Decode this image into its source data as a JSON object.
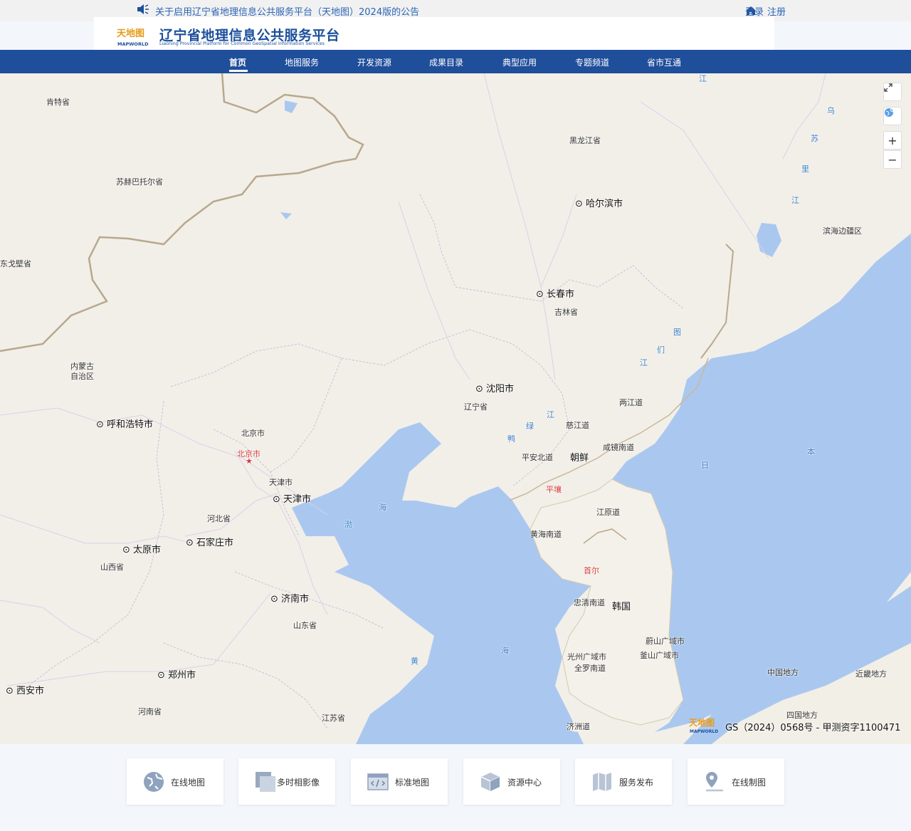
{
  "notice": {
    "text": "关于启用辽宁省地理信息公共服务平台（天地图）2024版的公告"
  },
  "header": {
    "login": "登录",
    "register": "注册"
  },
  "brand": {
    "title": "辽宁省地理信息公共服务平台",
    "subtitle": "Liaoning Provincial Platform for Common GeoSpatial Information Services",
    "logo_text": "MAPWORLD"
  },
  "nav": {
    "items": [
      "首页",
      "地图服务",
      "开发资源",
      "成果目录",
      "典型应用",
      "专题频道",
      "省市互通"
    ]
  },
  "map": {
    "tools": {
      "zoom_in": "+",
      "zoom_out": "−"
    },
    "labels": {
      "kenteaimag": "肯特省",
      "sukhbaatar": "苏赫巴托尔省",
      "dornogovi": "东戈壁省",
      "heilongjiang": "黑龙江省",
      "harbin": "哈尔滨市",
      "changchun": "长春市",
      "jilin": "吉林省",
      "neimenggu": "内蒙古\n自治区",
      "hohhot": "呼和浩特市",
      "shenyang": "沈阳市",
      "liaoning": "辽宁省",
      "beijing_prov": "北京市",
      "beijing": "北京市",
      "tianjin_prov": "天津市",
      "tianjin": "天津市",
      "hebei": "河北省",
      "shijiazhuang": "石家庄市",
      "taiyuan": "太原市",
      "shanxi": "山西省",
      "jinan": "济南市",
      "shandong": "山东省",
      "zhengzhou": "郑州市",
      "henan": "河南省",
      "xian": "西安市",
      "jiangsu": "江苏省",
      "binhai": "滨海边疆区",
      "lianggang": "两江道",
      "cijiang": "慈江道",
      "xianjingnan": "咸镜南道",
      "pinganbei": "平安北道",
      "chaoxian": "朝鲜",
      "pyongyang": "平壤",
      "jiangyuan": "江原道",
      "huanghainan": "黄海南道",
      "seoul": "首尔",
      "zhongqingnan": "忠清南道",
      "hanguo": "韩国",
      "ulsan": "蔚山广域市",
      "busan": "釜山广域市",
      "gwangju": "光州广域市",
      "quanluonan": "全罗南道",
      "jeju": "济洲道",
      "chugoku": "中国地方",
      "kinki": "近畿地方",
      "shikoku": "四国地方"
    },
    "water": {
      "jiang_top": "江",
      "wu": "乌",
      "su": "苏",
      "li": "里",
      "jiang2": "江",
      "tu": "图",
      "men": "们",
      "jiang3": "江",
      "lu": "绿",
      "jiang4": "江",
      "ya": "鸭",
      "bo": "渤",
      "hai_bo": "海",
      "huang": "黄",
      "hai_huang": "海",
      "ri": "日",
      "ben": "本"
    },
    "gs_text": "GS（2024）0568号 - 甲测资字1100471"
  },
  "quicklinks": [
    "在线地图",
    "多时相影像",
    "标准地图",
    "资源中心",
    "服务发布",
    "在线制图"
  ]
}
